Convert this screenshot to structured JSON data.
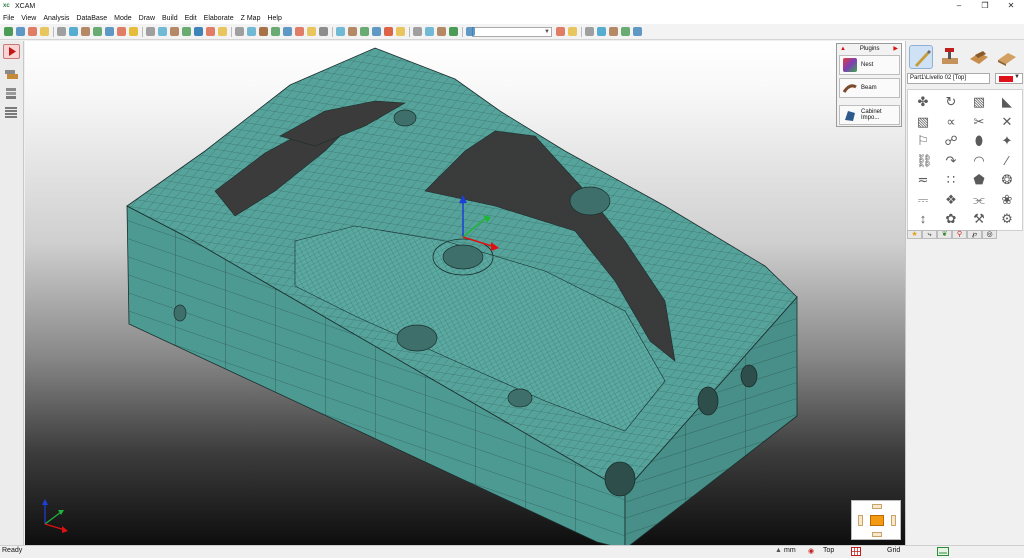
{
  "window": {
    "app_name": "XCAM",
    "app_icon": "xcam-logo-icon",
    "controls": [
      "minimize-icon",
      "restore-icon",
      "close-icon"
    ]
  },
  "menu": [
    "File",
    "View",
    "Analysis",
    "DataBase",
    "Mode",
    "Draw",
    "Build",
    "Edit",
    "Elaborate",
    "Z Map",
    "Help"
  ],
  "toolbar": {
    "icon_count": 44,
    "combo_value": "",
    "accent_colors": [
      "#2e8b3a",
      "#1f6fb0",
      "#d64a2a",
      "#e3b21c"
    ]
  },
  "left_toolbar": {
    "items": [
      "play-icon",
      "layers-icon",
      "stack-icon",
      "sheets-icon"
    ]
  },
  "plugins_panel": {
    "title": "Plugins",
    "items": [
      {
        "label": "Nest",
        "icon": "nest-icon"
      },
      {
        "label": "Beam",
        "icon": "beam-icon"
      },
      {
        "label": "Cabinet Impo...",
        "icon": "cabinet-import-icon"
      }
    ]
  },
  "right_panel": {
    "top_icons": [
      "draw-pen-icon",
      "hammer-icon",
      "material-icon",
      "board-icon"
    ],
    "selection": "Part1\\Livello 02 [Top]",
    "color": "#e0101a",
    "tools": [
      "group-icon",
      "rotate-icon",
      "shape-icon",
      "wedge-icon",
      "profile-icon",
      "curve-icon",
      "trim-icon",
      "cross-icon",
      "joint-icon",
      "link-icon",
      "drill-icon",
      "pick-icon",
      "chain-icon",
      "trace-icon",
      "arc-icon",
      "line-icon",
      "path-icon",
      "array-icon",
      "surface-icon",
      "knot-icon",
      "step-icon",
      "pocket-icon",
      "offset-icon",
      "swirl-icon",
      "bevel-icon",
      "pattern-icon",
      "tool-icon",
      "gear-icon"
    ],
    "tabs": [
      "star-icon",
      "tool-tab-icon",
      "leaf-icon",
      "pin-icon",
      "p-icon",
      "globe-icon"
    ]
  },
  "status": {
    "left": "Ready",
    "units": "mm",
    "view": "Top",
    "grid": "Grid"
  },
  "colors": {
    "model_fill": "#4d9a93",
    "model_dark": "#3b3b3b",
    "model_edge": "#1a2e2c",
    "axis_x": "#e01010",
    "axis_y": "#21b43a",
    "axis_z": "#1d3fd6"
  }
}
